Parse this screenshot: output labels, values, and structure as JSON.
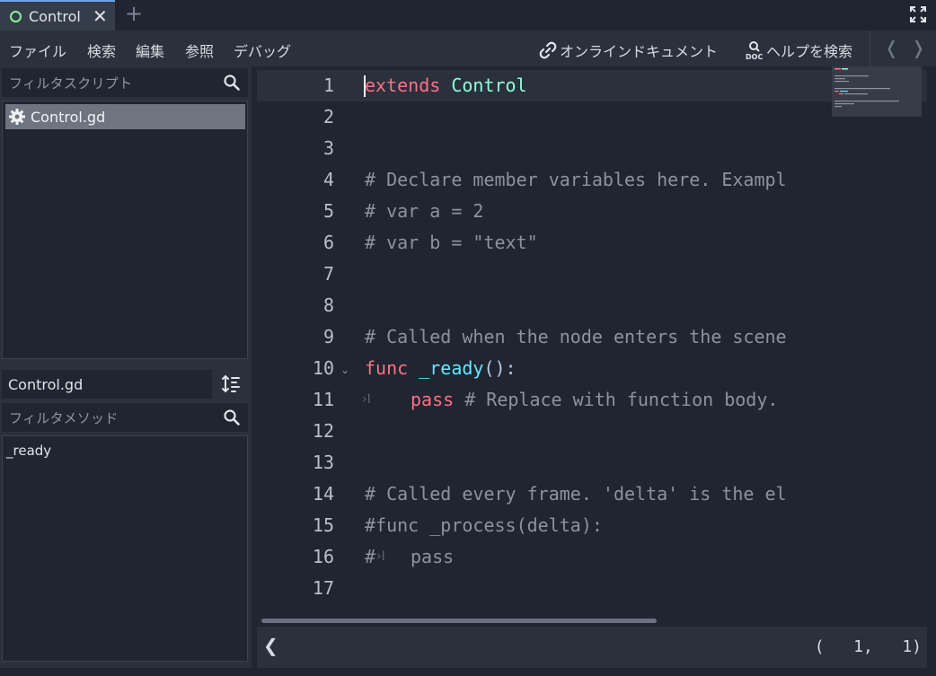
{
  "tab": {
    "title": "Control",
    "close": "✕",
    "add": "+"
  },
  "menu": {
    "file": "ファイル",
    "search": "検索",
    "edit": "編集",
    "goto": "参照",
    "debug": "デバッグ",
    "online_docs": "オンラインドキュメント",
    "search_help": "ヘルプを検索",
    "back": "❬",
    "forward": "❭"
  },
  "left_panel": {
    "filter_scripts_placeholder": "フィルタスクリプト",
    "scripts": [
      "Control.gd"
    ],
    "current_script": "Control.gd",
    "filter_methods_placeholder": "フィルタメソッド",
    "methods": [
      "_ready"
    ]
  },
  "editor": {
    "line_numbers": [
      "1",
      "2",
      "3",
      "4",
      "5",
      "6",
      "7",
      "8",
      "9",
      "10",
      "11",
      "12",
      "13",
      "14",
      "15",
      "16",
      "17"
    ],
    "lines": {
      "l1_kw": "extends",
      "l1_type": "Control",
      "l4": "# Declare member variables here. Exampl",
      "l5": "# var a = 2",
      "l6": "# var b = \"text\"",
      "l9": "# Called when the node enters the scene",
      "l10_kw": "func",
      "l10_fn": "_ready",
      "l10_sym": "():",
      "l11_kw": "pass",
      "l11_cm": "# Replace with function body.",
      "l14": "# Called every frame. 'delta' is the el",
      "l15": "#func _process(delta):",
      "l16_hash": "#",
      "l16_rest": "pass"
    },
    "tab_glyph": "›I"
  },
  "status": {
    "left_arrow": "❮",
    "position": "(   1,   1)"
  },
  "colors": {
    "accent": "#6fa3e8",
    "keyword": "#ff7085",
    "type": "#8effda",
    "function": "#66e6ff",
    "comment": "#8c93a0"
  }
}
